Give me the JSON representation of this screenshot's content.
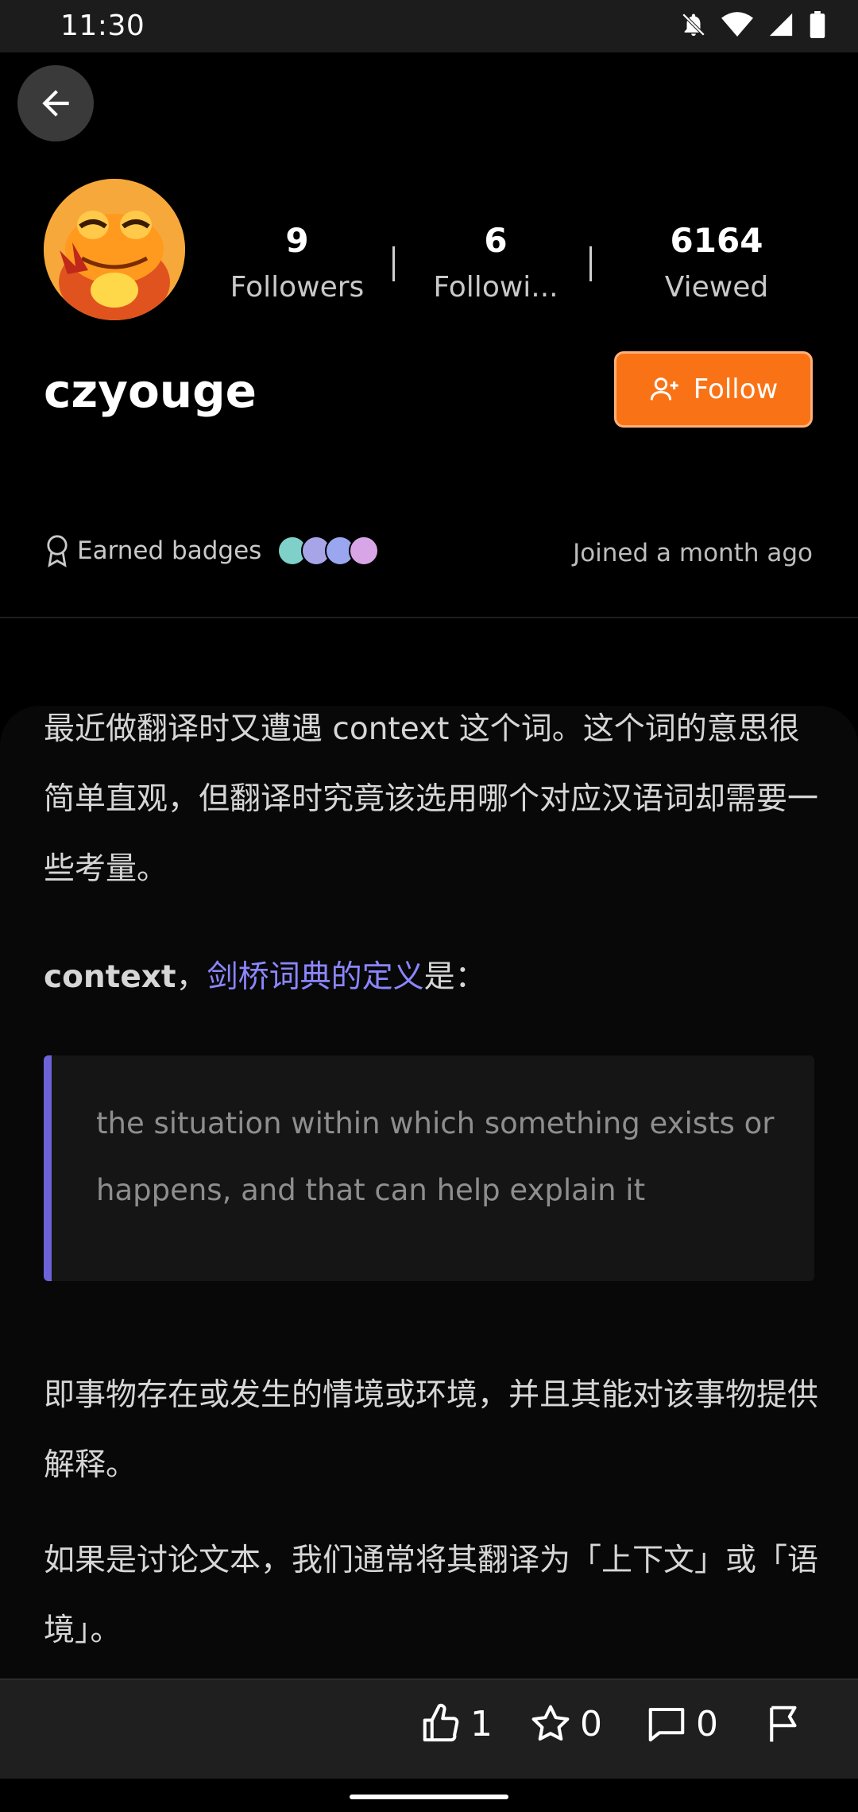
{
  "status": {
    "time": "11:30"
  },
  "profile": {
    "username": "czyouge",
    "stats": [
      {
        "value": "9",
        "label": "Followers"
      },
      {
        "value": "6",
        "label": "Followi..."
      },
      {
        "value": "6164",
        "label": "Viewed"
      }
    ],
    "follow_label": "Follow",
    "badges_label": "Earned badges",
    "joined": "Joined a month ago"
  },
  "article": {
    "p1": "最近做翻译时又遭遇 context 这个词。这个词的意思很简单直观，但翻译时究竟该选用哪个对应汉语词却需要一些考量。",
    "p2_word": "context",
    "p2_sep": "，",
    "p2_link": "剑桥词典的定义",
    "p2_tail": "是：",
    "quote": "the situation within which something exists or happens, and that can help explain it",
    "p3": "即事物存在或发生的情境或环境，并且其能对该事物提供解释。",
    "p4": "如果是讨论文本，我们通常将其翻译为「上下文」或「语境」。"
  },
  "actions": {
    "like_count": "1",
    "star_count": "0",
    "comment_count": "0"
  },
  "colors": {
    "accent": "#f97316",
    "link": "#8b86ff",
    "quote_bar": "#6c63d8"
  }
}
